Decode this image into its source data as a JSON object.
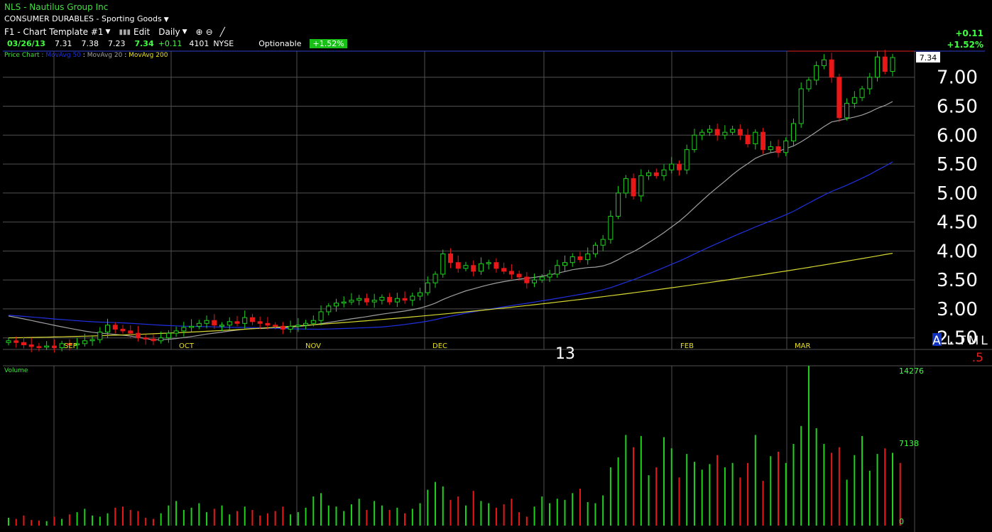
{
  "header": {
    "title": "NLS - Nautilus Group Inc",
    "sector": "CONSUMER DURABLES - Sporting Goods",
    "template": "F1 - Chart Template #1",
    "edit_label": "Edit",
    "period": "Daily",
    "right_change": "+0.11",
    "right_pct": "+1.52%"
  },
  "quote": {
    "date": "03/26/13",
    "open": "7.31",
    "high": "7.38",
    "low": "7.23",
    "last": "7.34",
    "change": "+0.11",
    "volume": "4101",
    "exchange": "NYSE",
    "optionable": "Optionable",
    "pct": "+1.52%"
  },
  "legend": {
    "price_chart": "Price Chart :",
    "ma50": "MovAvg 50",
    "sep1": ":",
    "ma20": "MovAvg 20",
    "sep2": ":",
    "ma200": "MovAvg 200"
  },
  "price_axis": [
    "7.00",
    "6.50",
    "6.00",
    "5.50",
    "5.00",
    "4.50",
    "4.00",
    "3.50",
    "3.00",
    "2.50"
  ],
  "last_price_label": "7.34",
  "months": [
    "SEP",
    "OCT",
    "NOV",
    "DEC",
    "FEB",
    "MAR"
  ],
  "year_label": "13",
  "scale_buttons": {
    "a": "A",
    "l": "L",
    "t": "T",
    "m": "M",
    "l2": "L"
  },
  "red_five": ".5",
  "volume_panel": {
    "label": "Volume",
    "axis": [
      "14276",
      "7138",
      "0"
    ]
  },
  "colors": {
    "up": "#1ed21e",
    "down": "#e81818",
    "ma20": "#a0a0a0",
    "ma50": "#2030e0",
    "ma200": "#d8d830",
    "grid": "#505050"
  },
  "chart_data": {
    "type": "candlestick",
    "price_range": [
      2.3,
      7.45
    ],
    "volume_range": [
      0,
      14276
    ],
    "x_labels": [
      "SEP",
      "OCT",
      "NOV",
      "DEC",
      "13",
      "FEB",
      "MAR"
    ],
    "candles_close": [
      2.45,
      2.42,
      2.38,
      2.35,
      2.34,
      2.36,
      2.33,
      2.4,
      2.38,
      2.4,
      2.45,
      2.47,
      2.6,
      2.72,
      2.65,
      2.62,
      2.58,
      2.5,
      2.48,
      2.45,
      2.5,
      2.58,
      2.62,
      2.68,
      2.7,
      2.75,
      2.8,
      2.72,
      2.72,
      2.78,
      2.75,
      2.85,
      2.78,
      2.75,
      2.72,
      2.7,
      2.65,
      2.7,
      2.72,
      2.75,
      2.8,
      2.95,
      3.05,
      3.1,
      3.12,
      3.15,
      3.18,
      3.12,
      3.15,
      3.2,
      3.12,
      3.18,
      3.15,
      3.22,
      3.28,
      3.45,
      3.6,
      3.95,
      3.8,
      3.7,
      3.75,
      3.65,
      3.78,
      3.8,
      3.7,
      3.65,
      3.6,
      3.55,
      3.45,
      3.5,
      3.55,
      3.6,
      3.75,
      3.8,
      3.9,
      3.85,
      3.95,
      4.1,
      4.2,
      4.6,
      5.0,
      5.25,
      4.95,
      5.3,
      5.35,
      5.3,
      5.4,
      5.5,
      5.4,
      5.75,
      6.0,
      6.05,
      6.1,
      6.0,
      6.05,
      6.1,
      6.0,
      5.85,
      6.05,
      5.75,
      5.8,
      5.7,
      5.9,
      6.2,
      6.8,
      6.95,
      7.2,
      7.3,
      7.0,
      6.3,
      6.55,
      6.65,
      6.8,
      7.0,
      7.35,
      7.1,
      7.34
    ],
    "volume_values": [
      700,
      600,
      900,
      500,
      450,
      400,
      800,
      600,
      1000,
      1200,
      1500,
      900,
      800,
      1100,
      1600,
      1700,
      1400,
      1300,
      700,
      600,
      1100,
      1800,
      2200,
      1400,
      1600,
      2000,
      1200,
      1500,
      1800,
      1000,
      1300,
      1700,
      1400,
      900,
      1100,
      1300,
      1700,
      1000,
      1200,
      1600,
      2600,
      2900,
      1800,
      1700,
      1300,
      1900,
      2400,
      1400,
      2200,
      1800,
      1400,
      1600,
      1100,
      1500,
      2000,
      3200,
      3900,
      3500,
      2300,
      2600,
      1800,
      3100,
      2200,
      2000,
      1600,
      1900,
      2400,
      1200,
      800,
      1700,
      2600,
      2000,
      2400,
      2300,
      2900,
      3300,
      2100,
      2000,
      2700,
      5200,
      6100,
      8100,
      7000,
      8000,
      4500,
      5200,
      7900,
      6900,
      4300,
      6400,
      5700,
      5000,
      5500,
      6300,
      5200,
      5600,
      4300,
      5600,
      8100,
      4000,
      6200,
      6600,
      5600,
      7300,
      8900,
      14276,
      8700,
      7300,
      6500,
      7000,
      4100,
      6300,
      8000,
      4900,
      6400,
      6900,
      6500,
      5600
    ],
    "ma20_note": "MovAvg 20",
    "ma50_note": "MovAvg 50",
    "ma200_note": "MovAvg 200"
  }
}
